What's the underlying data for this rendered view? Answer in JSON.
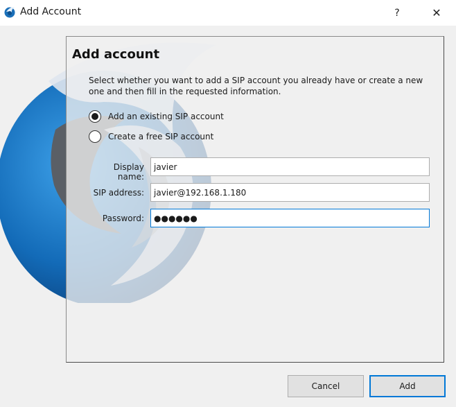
{
  "window": {
    "title": "Add Account",
    "help_label": "?",
    "close_label": "✕"
  },
  "panel": {
    "title": "Add account",
    "description": "Select whether you want to add a SIP account you already have or create a new one and then fill in the requested information."
  },
  "options": [
    {
      "label": "Add an existing SIP account",
      "selected": true
    },
    {
      "label": "Create a free SIP account",
      "selected": false
    }
  ],
  "form": {
    "display_name_label": "Display name:",
    "display_name_value": "javier",
    "sip_address_label": "SIP address:",
    "sip_address_value": "javier@192.168.1.180",
    "password_label": "Password:",
    "password_masked": "●●●●●●"
  },
  "buttons": {
    "cancel_label": "Cancel",
    "add_label": "Add"
  },
  "colors": {
    "accent": "#0078d7",
    "logo_blue": "#1a76c2"
  }
}
